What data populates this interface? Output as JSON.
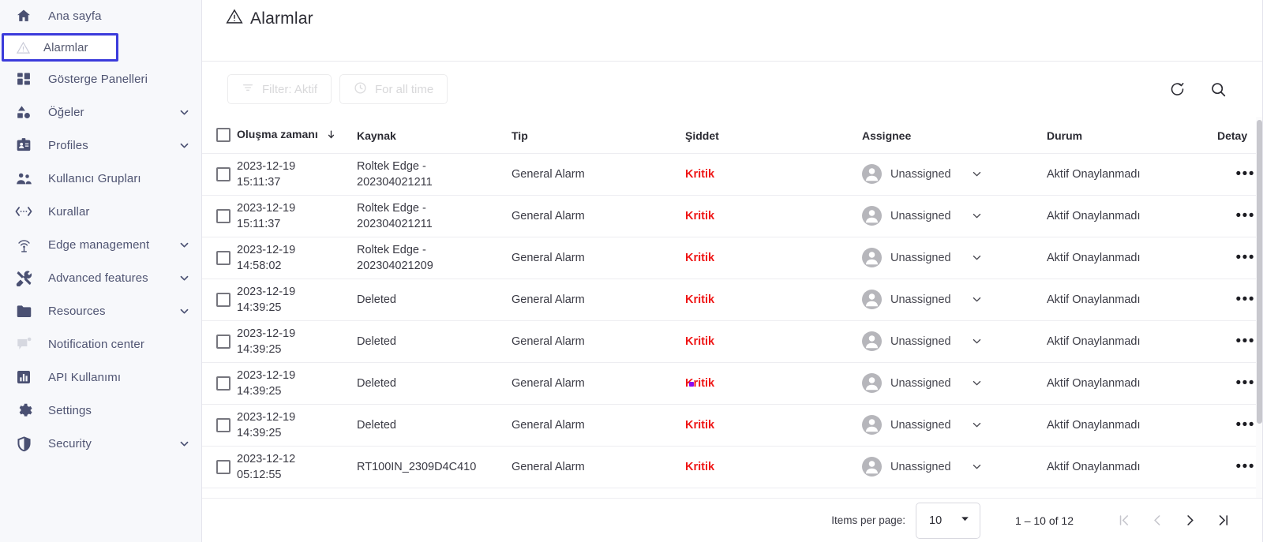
{
  "sidebar": {
    "items": [
      {
        "label": "Ana sayfa",
        "icon": "home-icon",
        "expandable": false,
        "selected": false
      },
      {
        "label": "Alarmlar",
        "icon": "alarm-warning-icon",
        "expandable": false,
        "selected": true
      },
      {
        "label": "Gösterge Panelleri",
        "icon": "dashboards-icon",
        "expandable": false,
        "selected": false
      },
      {
        "label": "Öğeler",
        "icon": "entities-icon",
        "expandable": true,
        "selected": false
      },
      {
        "label": "Profiles",
        "icon": "profile-badge-icon",
        "expandable": true,
        "selected": false
      },
      {
        "label": "Kullanıcı Grupları",
        "icon": "user-groups-icon",
        "expandable": false,
        "selected": false
      },
      {
        "label": "Kurallar",
        "icon": "rules-chain-icon",
        "expandable": false,
        "selected": false
      },
      {
        "label": "Edge management",
        "icon": "edge-antenna-icon",
        "expandable": true,
        "selected": false
      },
      {
        "label": "Advanced features",
        "icon": "tools-icon",
        "expandable": true,
        "selected": false
      },
      {
        "label": "Resources",
        "icon": "folder-icon",
        "expandable": true,
        "selected": false
      },
      {
        "label": "Notification center",
        "icon": "notification-flag-icon",
        "expandable": false,
        "selected": false
      },
      {
        "label": "API Kullanımı",
        "icon": "bar-chart-icon",
        "expandable": false,
        "selected": false
      },
      {
        "label": "Settings",
        "icon": "gear-icon",
        "expandable": false,
        "selected": false
      },
      {
        "label": "Security",
        "icon": "shield-icon",
        "expandable": true,
        "selected": false
      }
    ]
  },
  "header": {
    "title": "Alarmlar",
    "icon": "alarm-warning-icon"
  },
  "toolbar": {
    "filter_chip": "Filter: Aktif",
    "time_chip": "For all time",
    "refresh_icon": "refresh-icon",
    "search_icon": "search-icon"
  },
  "table": {
    "columns": [
      {
        "key": "select",
        "label": ""
      },
      {
        "key": "time",
        "label": "Oluşma zamanı",
        "sorted": true,
        "sort_dir": "desc"
      },
      {
        "key": "source",
        "label": "Kaynak"
      },
      {
        "key": "type",
        "label": "Tip"
      },
      {
        "key": "severity",
        "label": "Şiddet"
      },
      {
        "key": "assignee",
        "label": "Assignee"
      },
      {
        "key": "status",
        "label": "Durum"
      },
      {
        "key": "detail",
        "label": "Detay"
      }
    ],
    "rows": [
      {
        "date": "2023-12-19",
        "time": "15:11:37",
        "source_l1": "Roltek Edge -",
        "source_l2": "202304021211",
        "type": "General Alarm",
        "severity": "Kritik",
        "assignee": "Unassigned",
        "status": "Aktif Onaylanmadı",
        "actions": "•••"
      },
      {
        "date": "2023-12-19",
        "time": "15:11:37",
        "source_l1": "Roltek Edge -",
        "source_l2": "202304021211",
        "type": "General Alarm",
        "severity": "Kritik",
        "assignee": "Unassigned",
        "status": "Aktif Onaylanmadı",
        "actions": "•••"
      },
      {
        "date": "2023-12-19",
        "time": "14:58:02",
        "source_l1": "Roltek Edge -",
        "source_l2": "202304021209",
        "type": "General Alarm",
        "severity": "Kritik",
        "assignee": "Unassigned",
        "status": "Aktif Onaylanmadı",
        "actions": "•••"
      },
      {
        "date": "2023-12-19",
        "time": "14:39:25",
        "source_l1": "Deleted",
        "source_l2": "",
        "type": "General Alarm",
        "severity": "Kritik",
        "assignee": "Unassigned",
        "status": "Aktif Onaylanmadı",
        "actions": "•••"
      },
      {
        "date": "2023-12-19",
        "time": "14:39:25",
        "source_l1": "Deleted",
        "source_l2": "",
        "type": "General Alarm",
        "severity": "Kritik",
        "assignee": "Unassigned",
        "status": "Aktif Onaylanmadı",
        "actions": "•••"
      },
      {
        "date": "2023-12-19",
        "time": "14:39:25",
        "source_l1": "Deleted",
        "source_l2": "",
        "type": "General Alarm",
        "severity": "Kritik",
        "assignee": "Unassigned",
        "status": "Aktif Onaylanmadı",
        "actions": "•••"
      },
      {
        "date": "2023-12-19",
        "time": "14:39:25",
        "source_l1": "Deleted",
        "source_l2": "",
        "type": "General Alarm",
        "severity": "Kritik",
        "assignee": "Unassigned",
        "status": "Aktif Onaylanmadı",
        "actions": "•••"
      },
      {
        "date": "2023-12-12",
        "time": "05:12:55",
        "source_l1": "RT100IN_2309D4C410",
        "source_l2": "",
        "type": "General Alarm",
        "severity": "Kritik",
        "assignee": "Unassigned",
        "status": "Aktif Onaylanmadı",
        "actions": "•••"
      }
    ]
  },
  "paginator": {
    "items_per_page_label": "Items per page:",
    "items_per_page_value": "10",
    "range_label": "1 – 10 of 12",
    "first_icon": "first-page-icon",
    "prev_icon": "prev-page-icon",
    "next_icon": "next-page-icon",
    "last_icon": "last-page-icon"
  },
  "colors": {
    "severity_critical": "#ef1616",
    "sidebar_bg": "#f7f8fb",
    "selection_outline": "#3b3bdb",
    "cursor_dot": "#8a09f0"
  }
}
